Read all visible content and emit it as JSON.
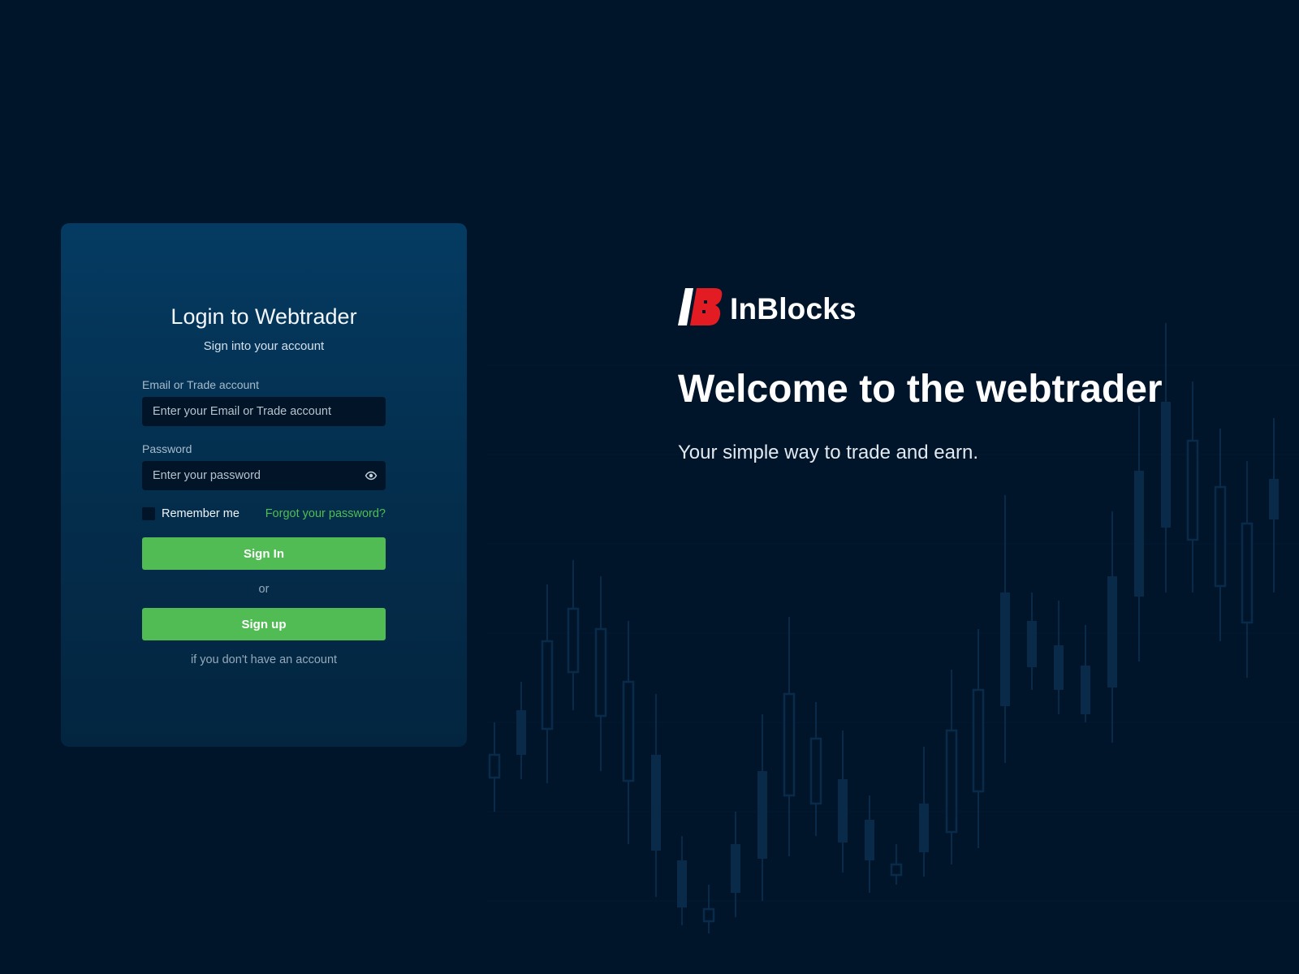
{
  "login_card": {
    "title": "Login to Webtrader",
    "subtitle": "Sign into your account",
    "email_label": "Email or Trade account",
    "email_placeholder": "Enter your Email or Trade account",
    "email_value": "",
    "password_label": "Password",
    "password_placeholder": "Enter your password",
    "password_value": "",
    "password_toggle_icon": "eye-icon",
    "remember_label": "Remember me",
    "remember_checked": false,
    "forgot_link": "Forgot your password?",
    "sign_in_button": "Sign In",
    "or_text": "or",
    "sign_up_button": "Sign up",
    "sign_up_note": "if you don't have an account"
  },
  "hero": {
    "brand_name": "InBlocks",
    "logo_icon": "inblocks-logo",
    "welcome": "Welcome to the webtrader",
    "tagline": "Your simple way to trade and earn."
  },
  "colors": {
    "background": "#00142a",
    "card_top": "#053b62",
    "card_bottom": "#032540",
    "accent_green": "#52bc54",
    "link_green": "#4fbe53",
    "logo_red": "#e31b23",
    "candle": "#0a2a4a"
  }
}
